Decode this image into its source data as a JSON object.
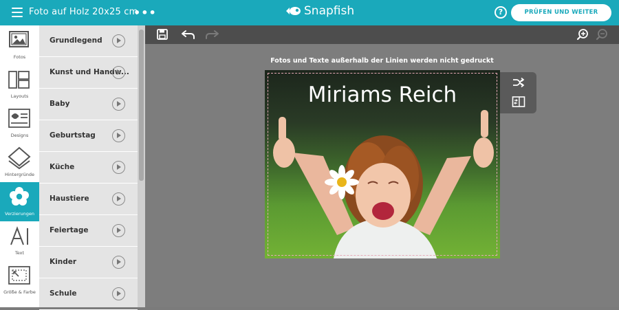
{
  "header": {
    "doc_title": "Foto auf Holz 20x25 cm",
    "brand_name": "Snapfish",
    "help_label": "?",
    "primary_action": "PRÜFEN UND WEITER"
  },
  "rail": {
    "items": [
      {
        "label": "Fotos",
        "icon": "photos-icon"
      },
      {
        "label": "Layouts",
        "icon": "layouts-icon"
      },
      {
        "label": "Designs",
        "icon": "designs-icon"
      },
      {
        "label": "Hintergründe",
        "icon": "backgrounds-icon"
      },
      {
        "label": "Verzierungen",
        "icon": "embellishments-icon"
      },
      {
        "label": "Text",
        "icon": "text-icon"
      },
      {
        "label": "Größe & Farbe",
        "icon": "size-color-icon"
      }
    ],
    "active_index": 4
  },
  "categories": [
    {
      "label": "Grundlegend"
    },
    {
      "label": "Kunst und Handw..."
    },
    {
      "label": "Baby"
    },
    {
      "label": "Geburtstag"
    },
    {
      "label": "Küche"
    },
    {
      "label": "Haustiere"
    },
    {
      "label": "Feiertage"
    },
    {
      "label": "Kinder"
    },
    {
      "label": "Schule"
    }
  ],
  "canvas": {
    "notice": "Fotos und Texte außerhalb der Linien werden nicht gedruckt",
    "photo_title": "Miriams Reich"
  },
  "colors": {
    "accent": "#1aa9bb",
    "toolbar": "#4d4d4d",
    "workspace": "#7d7d7d",
    "safe_line": "#e7a9b8"
  }
}
